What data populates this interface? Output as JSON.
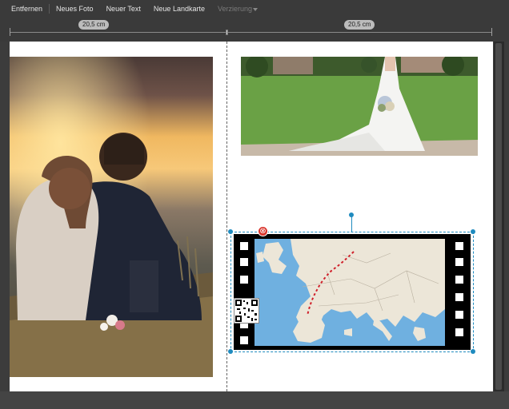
{
  "toolbar": {
    "remove_label": "Entfernen",
    "new_photo_label": "Neues Foto",
    "new_text_label": "Neuer Text",
    "new_map_label": "Neue Landkarte",
    "more_label": "Verzierung"
  },
  "ruler": {
    "left_width_label": "20,5 cm",
    "right_width_label": "20,5 cm"
  },
  "left_photo": {
    "icon": "couple-sunset-photo"
  },
  "right_photo": {
    "icon": "bride-photo"
  },
  "map_element": {
    "icon": "europe-map",
    "route_color": "#d0202a",
    "frame_color": "#000000",
    "selection_color": "#1f8bbf"
  },
  "delete_icon": "⊗"
}
